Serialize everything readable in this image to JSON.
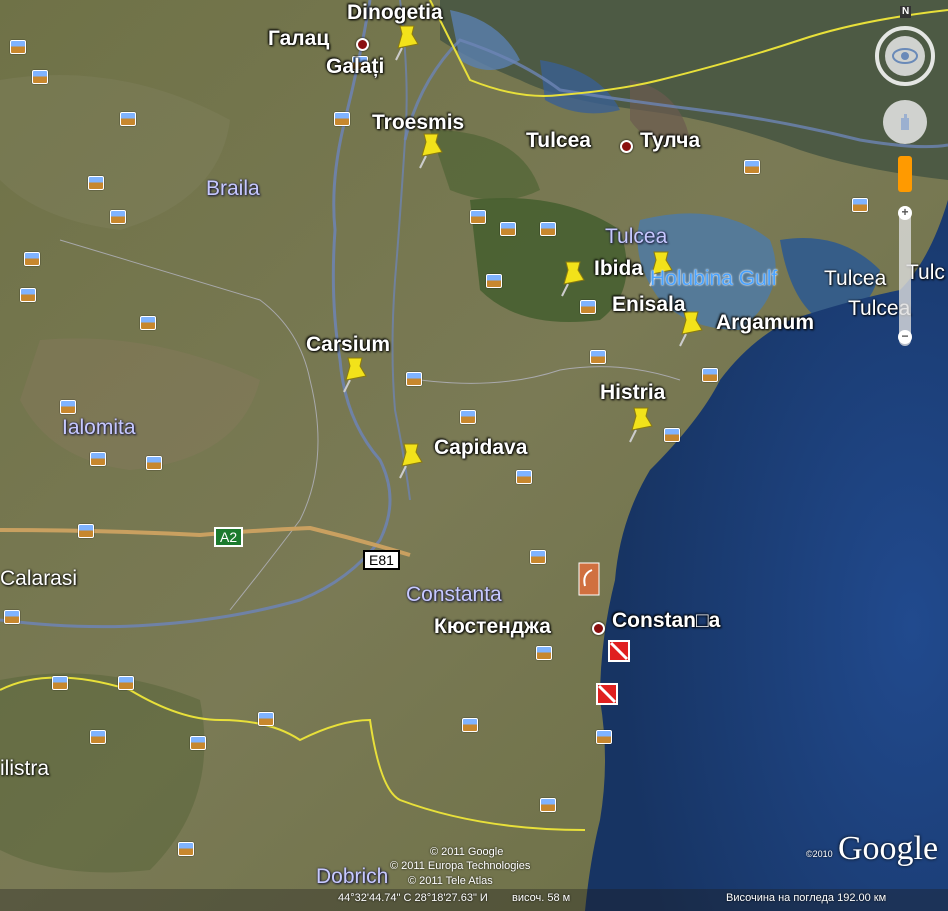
{
  "places": {
    "dinogetia": "Dinogetia",
    "galati_cyr": "Галац",
    "galati": "Galați",
    "troesmis": "Troesmis",
    "tulcea_city": "Tulcea",
    "tulcea_cyr": "Тулча",
    "braila": "Braila",
    "tulcea_region": "Tulcea",
    "ibida": "Ibida",
    "holubina": "Holubina Gulf",
    "tulcea_right1": "Tulcea",
    "tulcea_right2": "Tulcea",
    "tulcea_edge": "Tulc",
    "enisala": "Enisala",
    "argamum": "Argamum",
    "carsium": "Carsium",
    "histria": "Histria",
    "ialomita": "Ialomita",
    "capidava": "Capidava",
    "calarasi": "Calarasi",
    "constanta_region": "Constanta",
    "constanta_cyr": "Кюстенджа",
    "constanta": "Constan□a",
    "silistra": "ilistra",
    "dobrich": "Dobrich"
  },
  "roads": {
    "a2": "A2",
    "e81": "E81"
  },
  "copyright": {
    "line1": "© 2011 Google",
    "line2": "© 2011 Europa Technologies",
    "line3": "© 2011 Tele Atlas",
    "logo": "Google",
    "logo_year": "©2010"
  },
  "status": {
    "coords": "44°32'44.74\" С  28°18'27.63\" И",
    "elev": "височ.   58 м",
    "eye_alt": "Височина на погледа   192.00 км"
  },
  "nav": {
    "north": "N"
  },
  "icons": [
    "compass-icon",
    "look-joystick-icon",
    "move-joystick-icon",
    "pegman-icon",
    "zoom-in-icon",
    "zoom-out-icon",
    "pushpin-icon",
    "photo-icon",
    "city-dot-icon"
  ],
  "colors": {
    "sea": "#1e3f7a",
    "land": "#6b7240",
    "pin": "#f2e21a",
    "border_yellow": "#e8e03a",
    "water_label": "#4aa3ff"
  }
}
